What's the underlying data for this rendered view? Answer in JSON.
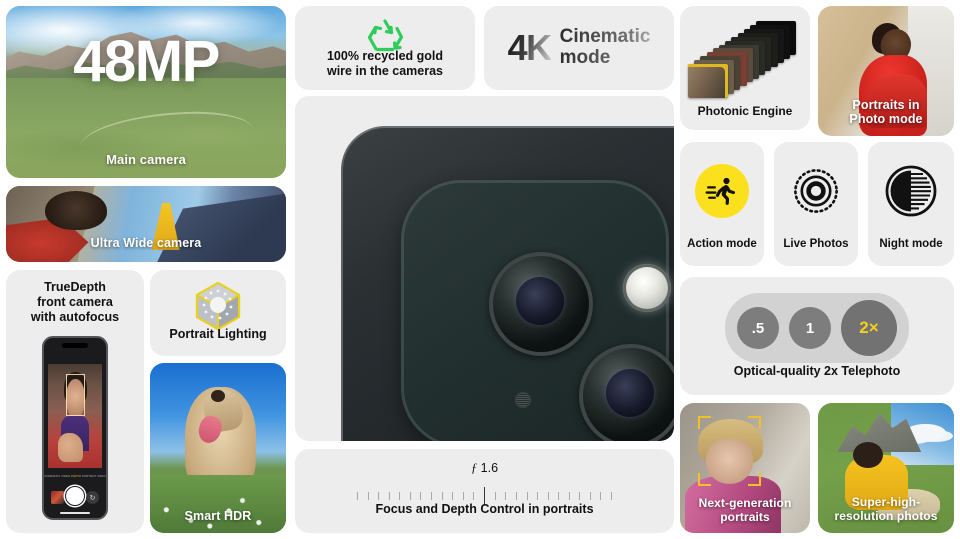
{
  "main_camera": {
    "megapixels": "48MP",
    "caption": "Main camera"
  },
  "ultra_wide": {
    "caption": "Ultra Wide camera"
  },
  "truedepth": {
    "label": "TrueDepth\nfront camera\nwith autofocus",
    "label_line1": "TrueDepth",
    "label_line2": "front camera",
    "label_line3": "with autofocus",
    "camera_modes": [
      "CINEMATIC",
      "VIDEO",
      "PHOTO",
      "PORTRAIT",
      "PANO"
    ],
    "selected_mode": "PHOTO"
  },
  "portrait_lighting": {
    "label": "Portrait Lighting",
    "icon": "lighting-cube-icon",
    "accent": "#f3d021"
  },
  "smart_hdr": {
    "caption": "Smart HDR"
  },
  "recycled_gold": {
    "icon": "recycle-icon",
    "icon_color": "#2ecc5a",
    "label_line1": "100% recycled gold",
    "label_line2": "wire in the cameras"
  },
  "cinematic": {
    "resolution": "4K",
    "label_line1": "Cinematic",
    "label_line2": "mode"
  },
  "camera_module": {
    "name": "rear-camera-module",
    "lenses": [
      "main-lens",
      "telephoto-lens"
    ],
    "flash": "true-tone-flash",
    "mic": "microphone"
  },
  "focus_depth": {
    "aperture_symbol": "ƒ",
    "aperture_value": "1.6",
    "label": "Focus and Depth Control in portraits",
    "tick_count": 25,
    "selected_tick_index": 12
  },
  "photonic_engine": {
    "label": "Photonic Engine",
    "frame_count": 12
  },
  "portraits_photo_mode": {
    "caption_line1": "Portraits in",
    "caption_line2": "Photo mode"
  },
  "modes": [
    {
      "label": "Action mode",
      "icon": "running-person-icon",
      "disc_color": "#fbe01e"
    },
    {
      "label": "Live Photos",
      "icon": "live-photos-icon",
      "disc_color": "#ededed"
    },
    {
      "label": "Night mode",
      "icon": "night-mode-icon",
      "disc_color": "#ededed"
    }
  ],
  "zoom_selector": {
    "options": [
      ".5",
      "1",
      "2×"
    ],
    "selected": "2×",
    "selected_color": "#f3d021",
    "label": "Optical-quality 2x Telephoto"
  },
  "next_gen_portraits": {
    "caption_line1": "Next-generation",
    "caption_line2": "portraits",
    "focus_box_color": "#f2c12a"
  },
  "super_high_res": {
    "caption_line1": "Super-high-",
    "caption_line2": "resolution photos"
  },
  "theme": {
    "page_background": "#ffffff",
    "card_background": "#ededed",
    "text_color": "#111111",
    "caption_color": "#ffffff"
  }
}
